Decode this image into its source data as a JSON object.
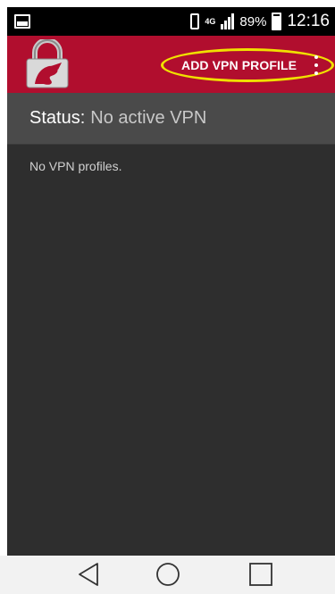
{
  "status_bar": {
    "network": "4G",
    "battery": "89%",
    "time": "12:16"
  },
  "app_bar": {
    "add_vpn_profile_label": "ADD VPN PROFILE",
    "highlight_color": "#f0e000",
    "accent": "#b10e2e"
  },
  "status": {
    "key": "Status:",
    "value": "No active VPN"
  },
  "content": {
    "empty_message": "No VPN profiles."
  },
  "navigation": {
    "icons": [
      "back-icon",
      "home-icon",
      "recent-apps-icon"
    ]
  }
}
